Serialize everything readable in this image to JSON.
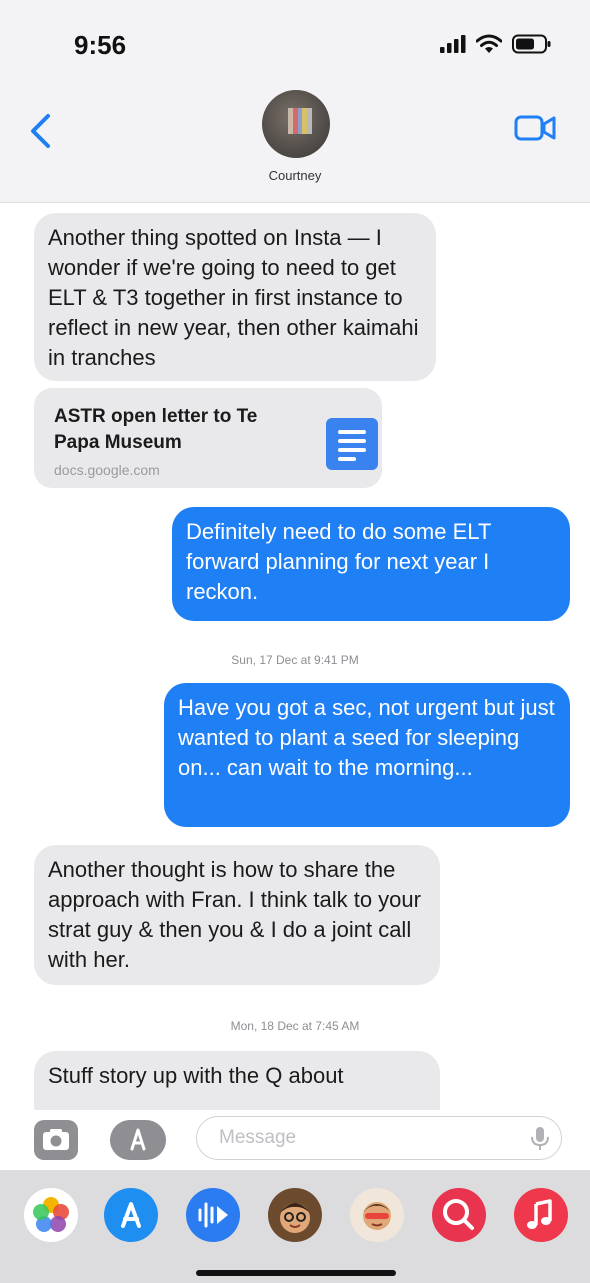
{
  "status_bar": {
    "time": "9:56"
  },
  "header": {
    "contact_name": "Courtney"
  },
  "messages": [
    {
      "text": "Another thing spotted on Insta — I wonder if we're going to need to get ELT & T3 together in first instance to reflect in new year, then other kaimahi in tranches"
    },
    {
      "text": "Definitely need to do some ELT forward planning for next year I reckon."
    },
    {
      "text": "Have you got a sec, not urgent but just wanted to plant a seed for sleeping on... can wait to the morning..."
    },
    {
      "text": "Another thought is how to share the approach with Fran. I think talk to your strat guy & then you & I do a joint call with her."
    },
    {
      "text": "Stuff story up with the Q about"
    }
  ],
  "link_preview": {
    "title": "ASTR open letter to Te Papa Museum",
    "domain": "docs.google.com",
    "icon": "google-docs-icon"
  },
  "timestamps": [
    "Sun, 17 Dec at 9:41 PM",
    "Mon, 18 Dec at 7:45 AM"
  ],
  "input_bar": {
    "placeholder": "Message"
  },
  "app_drawer": {
    "apps": [
      "photos-app-icon",
      "app-store-icon",
      "audio-message-icon",
      "memoji-icon",
      "memoji-stickers-icon",
      "image-search-icon",
      "music-app-icon"
    ]
  },
  "colors": {
    "outgoing_bubble": "#1f7ff5",
    "incoming_bubble": "#e9e9eb",
    "accent": "#1f7ff5"
  }
}
